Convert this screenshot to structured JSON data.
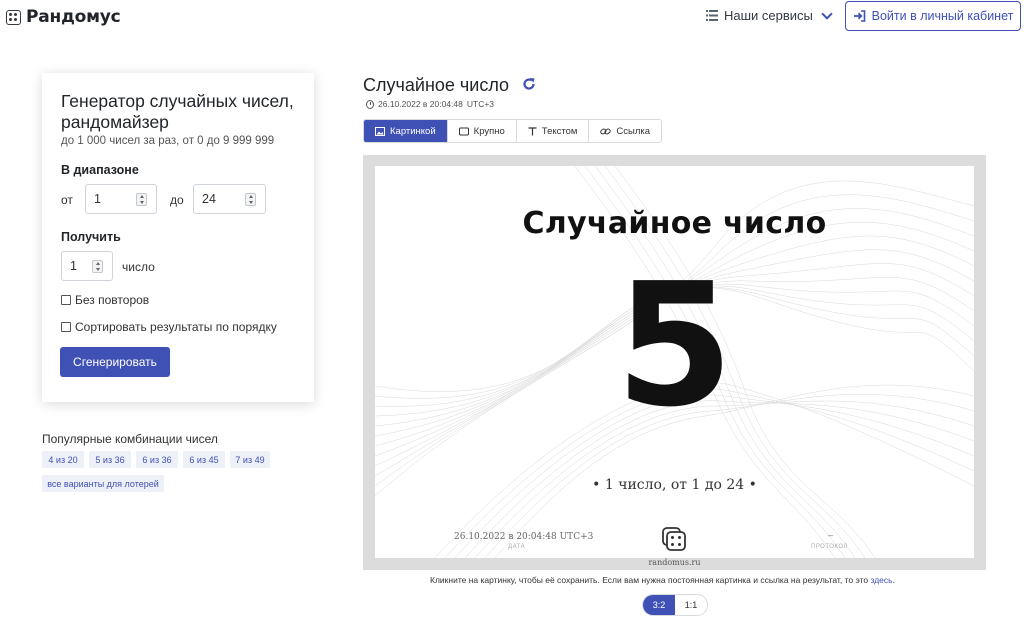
{
  "app": {
    "logo_text": "Рандомус",
    "services_label": "Наши сервисы",
    "login_label": "Войти в личный кабинет"
  },
  "form": {
    "title": "Генератор случайных чисел, рандомайзер",
    "subtitle": "до 1 000 чисел за раз, от 0 до 9 999 999",
    "range_label": "В диапазоне",
    "from_label": "от",
    "from_value": "1",
    "to_label": "до",
    "to_value": "24",
    "get_label": "Получить",
    "count_value": "1",
    "count_unit": "число",
    "no_repeat_label": "Без повторов",
    "no_repeat_checked": false,
    "sort_label": "Сортировать результаты по порядку",
    "sort_checked": false,
    "generate_label": "Сгенерировать"
  },
  "popular": {
    "title": "Популярные комбинации чисел",
    "chips": [
      "4 из 20",
      "5 из 36",
      "6 из 36",
      "6 из 45",
      "7 из 49",
      "все варианты для лотерей"
    ]
  },
  "result": {
    "title": "Случайное число",
    "timestamp": "26.10.2022 в 20:04:48",
    "timezone": "UTC+3",
    "tabs": [
      {
        "label": "Картинкой",
        "icon": "image-icon",
        "active": true
      },
      {
        "label": "Крупно",
        "icon": "square-icon",
        "active": false
      },
      {
        "label": "Текстом",
        "icon": "text-icon",
        "active": false
      },
      {
        "label": "Ссылка",
        "icon": "link-icon",
        "active": false
      }
    ]
  },
  "image": {
    "title": "Случайное число",
    "number": "5",
    "description": "•  1 число, от 1 до 24  •",
    "date": "26.10.2022 в 20:04:48 UTC+3",
    "date_label": "ДАТА",
    "protocol_value": "–",
    "protocol_label": "ПРОТОКОЛ",
    "site": "randomus.ru"
  },
  "hint": {
    "text": "Кликните на картинку, чтобы её сохранить. Если вам нужна постоянная картинка и ссылка на результат, то это ",
    "link": "здесь",
    "end": "."
  },
  "ratio": {
    "options": [
      "3:2",
      "1:1"
    ],
    "selected": "3:2"
  },
  "colors": {
    "accent": "#3f51b5",
    "frame": "#dcdcdc"
  }
}
